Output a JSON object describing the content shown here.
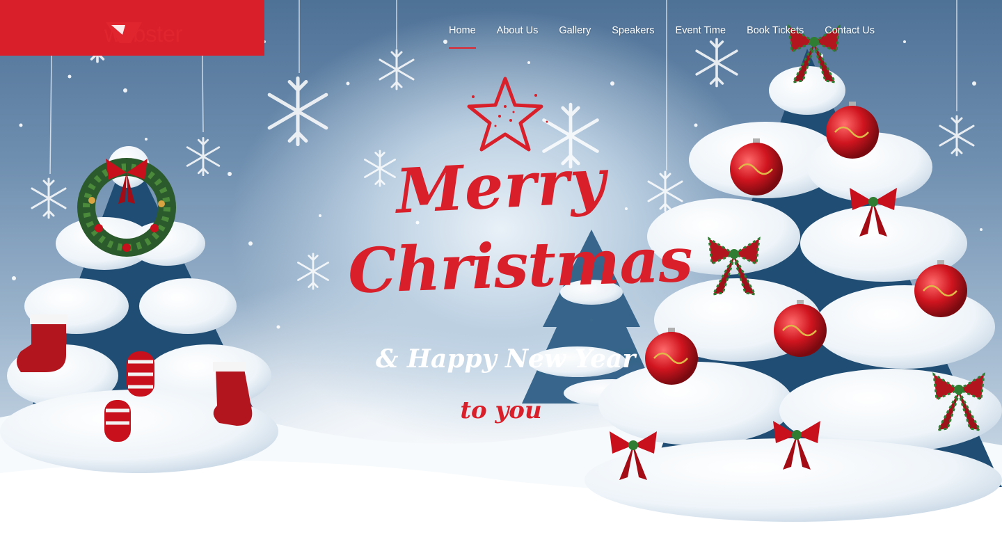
{
  "brand": {
    "name": "webster",
    "accent_color": "#e0252f",
    "logo_icon": "webster-logo-icon"
  },
  "nav": {
    "items": [
      {
        "label": "Home",
        "active": true
      },
      {
        "label": "About Us",
        "active": false
      },
      {
        "label": "Gallery",
        "active": false
      },
      {
        "label": "Speakers",
        "active": false
      },
      {
        "label": "Event Time",
        "active": false
      },
      {
        "label": "Book Tickets",
        "active": false
      },
      {
        "label": "Contact Us",
        "active": false
      }
    ]
  },
  "hero": {
    "line1": "Merry",
    "line2": "Christmas",
    "banner_text": "& Happy New Year",
    "line4": "to you",
    "text_color": "#d81f2a",
    "decorations": [
      "star-icon",
      "snowflake-icon",
      "christmas-tree-icon",
      "wreath-icon",
      "stocking-icon",
      "mitten-icon",
      "ornament-ball-icon",
      "bow-icon"
    ]
  }
}
